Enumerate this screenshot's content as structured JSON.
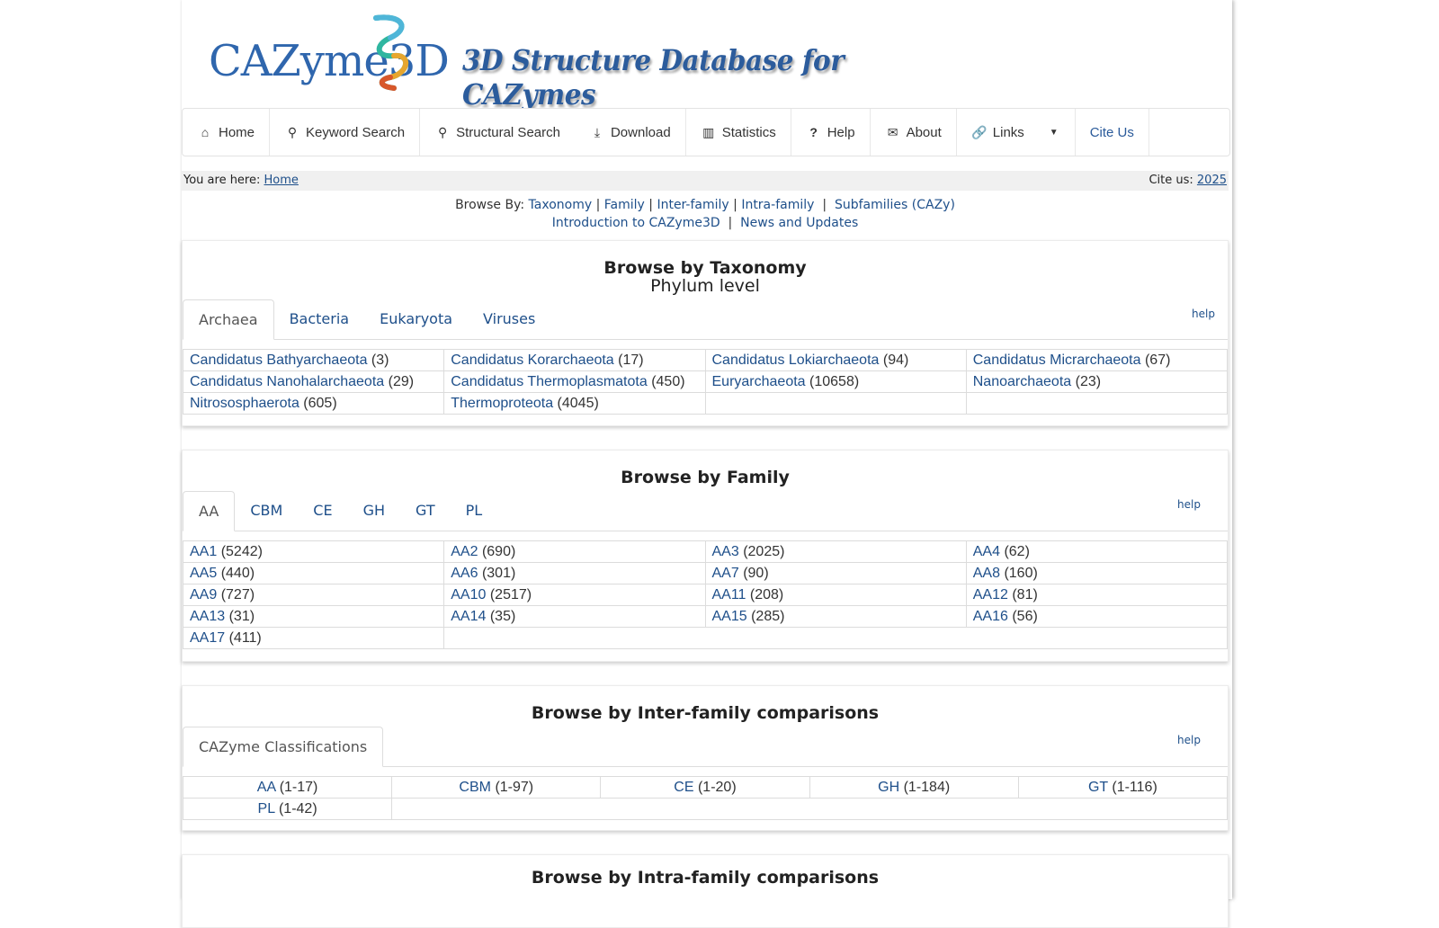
{
  "banner": {
    "logo_text": "CAZyme3D",
    "tagline": "3D Structure Database for CAZymes"
  },
  "nav": {
    "home": "Home",
    "keyword_search": "Keyword Search",
    "structural_search": "Structural Search",
    "download": "Download",
    "statistics": "Statistics",
    "help": "Help",
    "about": "About",
    "links": "Links",
    "cite_us": "Cite Us"
  },
  "breadcrumb": {
    "prefix": "You are here:",
    "home": "Home",
    "cite_prefix": "Cite us:",
    "cite_year": "2025"
  },
  "browse_by": {
    "label": "Browse By:",
    "taxonomy": "Taxonomy",
    "family": "Family",
    "inter_family": "Inter-family",
    "intra_family": "Intra-family",
    "subfamilies": "Subfamilies (CAZy)",
    "intro": "Introduction to CAZyme3D",
    "news": "News and Updates",
    "sep": "|"
  },
  "taxonomy_panel": {
    "title": "Browse by Taxonomy",
    "subtitle": "Phylum level",
    "help": "help",
    "tabs": [
      "Archaea",
      "Bacteria",
      "Eukaryota",
      "Viruses"
    ],
    "rows": [
      [
        {
          "name": "Candidatus Bathyarchaeota",
          "count": "(3)"
        },
        {
          "name": "Candidatus Korarchaeota",
          "count": "(17)"
        },
        {
          "name": "Candidatus Lokiarchaeota",
          "count": "(94)"
        },
        {
          "name": "Candidatus Micrarchaeota",
          "count": "(67)"
        }
      ],
      [
        {
          "name": "Candidatus Nanohalarchaeota",
          "count": "(29)"
        },
        {
          "name": "Candidatus Thermoplasmatota",
          "count": "(450)"
        },
        {
          "name": "Euryarchaeota",
          "count": "(10658)"
        },
        {
          "name": "Nanoarchaeota",
          "count": "(23)"
        }
      ],
      [
        {
          "name": "Nitrososphaerota",
          "count": "(605)"
        },
        {
          "name": "Thermoproteota",
          "count": "(4045)"
        },
        {
          "name": "",
          "count": ""
        },
        {
          "name": "",
          "count": ""
        }
      ]
    ]
  },
  "family_panel": {
    "title": "Browse by Family",
    "help": "help",
    "tabs": [
      "AA",
      "CBM",
      "CE",
      "GH",
      "GT",
      "PL"
    ],
    "rows": [
      [
        {
          "name": "AA1",
          "count": "(5242)"
        },
        {
          "name": "AA2",
          "count": "(690)"
        },
        {
          "name": "AA3",
          "count": "(2025)"
        },
        {
          "name": "AA4",
          "count": "(62)"
        }
      ],
      [
        {
          "name": "AA5",
          "count": "(440)"
        },
        {
          "name": "AA6",
          "count": "(301)"
        },
        {
          "name": "AA7",
          "count": "(90)"
        },
        {
          "name": "AA8",
          "count": "(160)"
        }
      ],
      [
        {
          "name": "AA9",
          "count": "(727)"
        },
        {
          "name": "AA10",
          "count": "(2517)"
        },
        {
          "name": "AA11",
          "count": "(208)"
        },
        {
          "name": "AA12",
          "count": "(81)"
        }
      ],
      [
        {
          "name": "AA13",
          "count": "(31)"
        },
        {
          "name": "AA14",
          "count": "(35)"
        },
        {
          "name": "AA15",
          "count": "(285)"
        },
        {
          "name": "AA16",
          "count": "(56)"
        }
      ],
      [
        {
          "name": "AA17",
          "count": "(411)"
        }
      ]
    ]
  },
  "inter_panel": {
    "title": "Browse by Inter-family comparisons",
    "help": "help",
    "tabs": [
      "CAZyme Classifications"
    ],
    "rows": [
      [
        {
          "name": "AA",
          "count": "(1-17)"
        },
        {
          "name": "CBM",
          "count": "(1-97)"
        },
        {
          "name": "CE",
          "count": "(1-20)"
        },
        {
          "name": "GH",
          "count": "(1-184)"
        },
        {
          "name": "GT",
          "count": "(1-116)"
        }
      ],
      [
        {
          "name": "PL",
          "count": "(1-42)"
        }
      ]
    ]
  },
  "intra_panel": {
    "title": "Browse by Intra-family comparisons"
  }
}
